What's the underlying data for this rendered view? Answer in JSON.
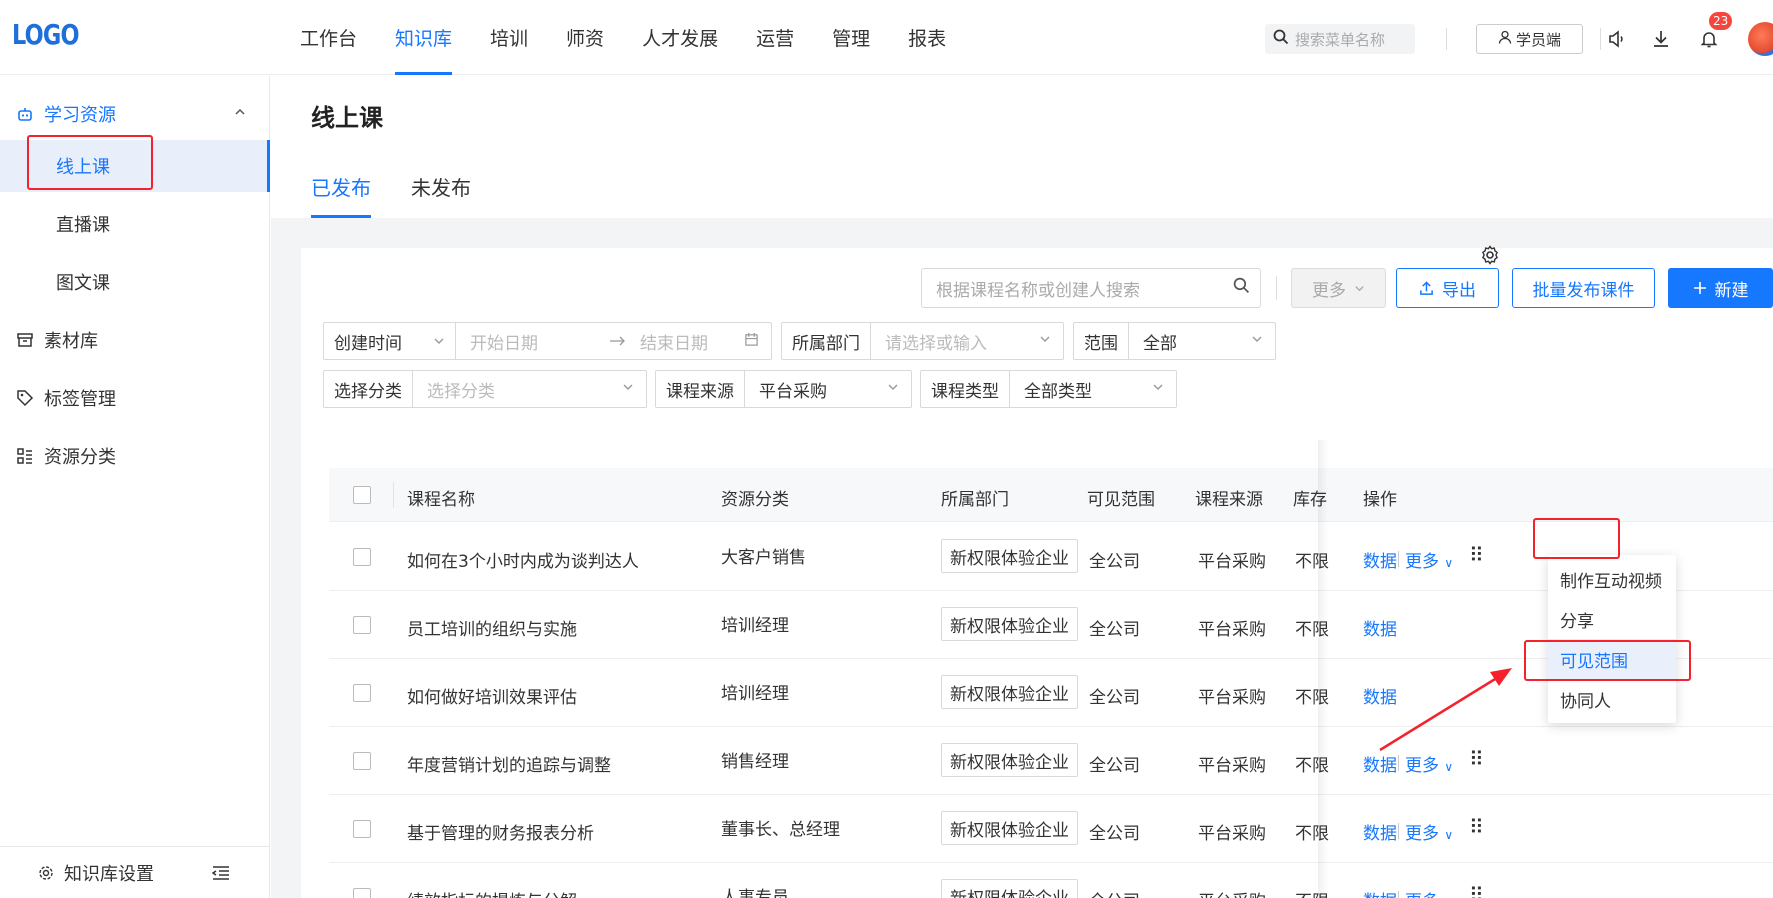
{
  "app": {
    "logo": "LOGO"
  },
  "nav": {
    "items": [
      {
        "label": "工作台",
        "active": false
      },
      {
        "label": "知识库",
        "active": true
      },
      {
        "label": "培训",
        "active": false
      },
      {
        "label": "师资",
        "active": false
      },
      {
        "label": "人才发展",
        "active": false
      },
      {
        "label": "运营",
        "active": false
      },
      {
        "label": "管理",
        "active": false
      },
      {
        "label": "报表",
        "active": false
      }
    ],
    "search_placeholder": "搜索菜单名称",
    "student_label": "学员端",
    "notification_count": "23"
  },
  "sidebar": {
    "group_label": "学习资源",
    "sub_items": [
      "线上课",
      "直播课",
      "图文课"
    ],
    "active_sub": "线上课",
    "items": [
      "素材库",
      "标签管理",
      "资源分类"
    ],
    "footer_label": "知识库设置"
  },
  "page": {
    "title": "线上课",
    "tabs": [
      {
        "label": "已发布",
        "active": true
      },
      {
        "label": "未发布",
        "active": false
      }
    ]
  },
  "toolbar": {
    "search_placeholder": "根据课程名称或创建人搜索",
    "more_label": "更多",
    "export_label": "导出",
    "batch_label": "批量发布课件",
    "new_label": "新建"
  },
  "filters": {
    "time": {
      "label": "创建时间",
      "start": "开始日期",
      "end": "结束日期"
    },
    "dept": {
      "label": "所属部门",
      "placeholder": "请选择或输入"
    },
    "scope": {
      "label": "范围",
      "value": "全部"
    },
    "category": {
      "label": "选择分类",
      "placeholder": "选择分类"
    },
    "source": {
      "label": "课程来源",
      "value": "平台采购"
    },
    "type": {
      "label": "课程类型",
      "value": "全部类型"
    }
  },
  "table": {
    "headers": {
      "name": "课程名称",
      "category": "资源分类",
      "dept": "所属部门",
      "scope": "可见范围",
      "source": "课程来源",
      "stock": "库存",
      "ops": "操作"
    },
    "op_data": "数据",
    "op_more": "更多",
    "rows": [
      {
        "name": "如何在3个小时内成为谈判达人",
        "category": "大客户销售",
        "dept": "新权限体验企业",
        "scope": "全公司",
        "source": "平台采购",
        "stock": "不限"
      },
      {
        "name": "员工培训的组织与实施",
        "category": "培训经理",
        "dept": "新权限体验企业",
        "scope": "全公司",
        "source": "平台采购",
        "stock": "不限"
      },
      {
        "name": "如何做好培训效果评估",
        "category": "培训经理",
        "dept": "新权限体验企业",
        "scope": "全公司",
        "source": "平台采购",
        "stock": "不限"
      },
      {
        "name": "年度营销计划的追踪与调整",
        "category": "销售经理",
        "dept": "新权限体验企业",
        "scope": "全公司",
        "source": "平台采购",
        "stock": "不限"
      },
      {
        "name": "基于管理的财务报表分析",
        "category": "董事长、总经理",
        "dept": "新权限体验企业",
        "scope": "全公司",
        "source": "平台采购",
        "stock": "不限"
      },
      {
        "name": "绩效指标的提炼与分解",
        "category": "人事专员",
        "dept": "新权限体验企业",
        "scope": "全公司",
        "source": "平台采购",
        "stock": "不限"
      }
    ]
  },
  "dropdown_menu": {
    "items": [
      "制作互动视频",
      "分享",
      "可见范围",
      "协同人"
    ],
    "highlighted": "可见范围"
  },
  "colors": {
    "primary": "#1677ff",
    "annotation": "#f5222d",
    "badge": "#f5453c"
  }
}
